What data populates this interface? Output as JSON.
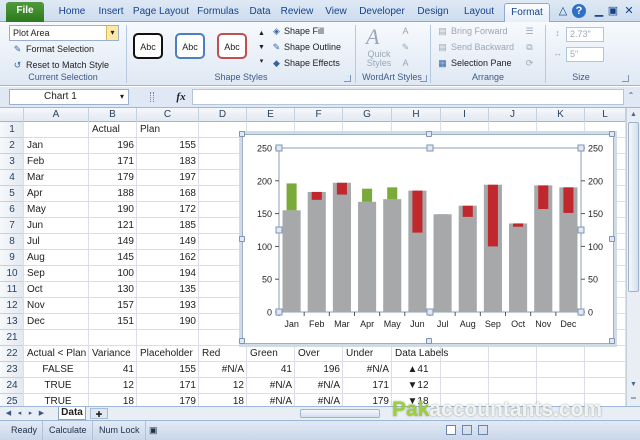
{
  "ribbon": {
    "tabs": [
      "File",
      "Home",
      "Insert",
      "Page Layout",
      "Formulas",
      "Data",
      "Review",
      "View",
      "Developer",
      "Design",
      "Layout",
      "Format"
    ],
    "active_tab": "Format",
    "current_selection": {
      "dropdown_value": "Plot Area",
      "format_selection": "Format Selection",
      "reset_style": "Reset to Match Style",
      "label": "Current Selection"
    },
    "shape_styles": {
      "swatches": [
        "Abc",
        "Abc",
        "Abc"
      ],
      "fill": "Shape Fill",
      "outline": "Shape Outline",
      "effects": "Shape Effects",
      "label": "Shape Styles"
    },
    "wordart": {
      "quick_styles": "Quick Styles",
      "label": "WordArt Styles"
    },
    "arrange": {
      "bring_forward": "Bring Forward",
      "send_backward": "Send Backward",
      "selection_pane": "Selection Pane",
      "label": "Arrange"
    },
    "size": {
      "height": "2.73\"",
      "width": "5\"",
      "label": "Size"
    }
  },
  "formula_bar": {
    "name_box": "Chart 1",
    "fx": "fx",
    "formula": ""
  },
  "grid": {
    "columns": [
      "A",
      "B",
      "C",
      "D",
      "E",
      "F",
      "G",
      "H",
      "I",
      "J",
      "K",
      "L"
    ],
    "rows": [
      "1",
      "2",
      "3",
      "4",
      "5",
      "6",
      "7",
      "8",
      "9",
      "10",
      "11",
      "12",
      "13",
      "21",
      "22",
      "23",
      "24",
      "25"
    ],
    "header_row": [
      "",
      "Actual",
      "Plan"
    ],
    "months": [
      "Jan",
      "Feb",
      "Mar",
      "Apr",
      "May",
      "Jun",
      "Jul",
      "Aug",
      "Sep",
      "Oct",
      "Nov",
      "Dec"
    ],
    "actual": [
      "196",
      "171",
      "179",
      "188",
      "190",
      "121",
      "149",
      "145",
      "100",
      "130",
      "157",
      "151"
    ],
    "plan": [
      "155",
      "183",
      "197",
      "168",
      "172",
      "185",
      "149",
      "162",
      "194",
      "135",
      "193",
      "190"
    ],
    "table2_headers": [
      "Actual < Plan",
      "Variance",
      "Placeholder",
      "Red",
      "Green",
      "Over",
      "Under",
      "Data Labels"
    ],
    "table2_rows": [
      [
        "FALSE",
        "41",
        "155",
        "#N/A",
        "41",
        "196",
        "#N/A",
        "▲41"
      ],
      [
        "TRUE",
        "12",
        "171",
        "12",
        "#N/A",
        "#N/A",
        "171",
        "▼12"
      ],
      [
        "TRUE",
        "18",
        "179",
        "18",
        "#N/A",
        "#N/A",
        "179",
        "▼18"
      ]
    ]
  },
  "chart_data": {
    "type": "bar",
    "categories": [
      "Jan",
      "Feb",
      "Mar",
      "Apr",
      "May",
      "Jun",
      "Jul",
      "Aug",
      "Sep",
      "Oct",
      "Nov",
      "Dec"
    ],
    "series": [
      {
        "values": [
          155,
          171,
          179,
          168,
          172,
          121,
          149,
          145,
          100,
          130,
          157,
          151
        ],
        "color": "#a6a8aa"
      },
      {
        "values": [
          41,
          0,
          0,
          20,
          18,
          0,
          0,
          0,
          0,
          0,
          0,
          0
        ],
        "color": "#7aaa3a"
      },
      {
        "values": [
          0,
          12,
          18,
          0,
          0,
          64,
          0,
          17,
          94,
          5,
          36,
          39
        ],
        "color": "#c0282d"
      }
    ],
    "overlay_bars": [
      155,
      183,
      197,
      168,
      172,
      185,
      149,
      162,
      194,
      135,
      193,
      190
    ],
    "ylim": [
      0,
      250
    ],
    "yticks": [
      "0",
      "50",
      "100",
      "150",
      "200",
      "250"
    ],
    "secondary_yticks": [
      "0",
      "50",
      "100",
      "150",
      "200",
      "250"
    ],
    "grid": false,
    "legend": "none"
  },
  "sheet_tabs": {
    "active": "Data"
  },
  "status_bar": {
    "ready": "Ready",
    "calculate": "Calculate",
    "num_lock": "Num Lock"
  },
  "watermark": {
    "pak": "Pak",
    "rest": "accountants.com"
  }
}
